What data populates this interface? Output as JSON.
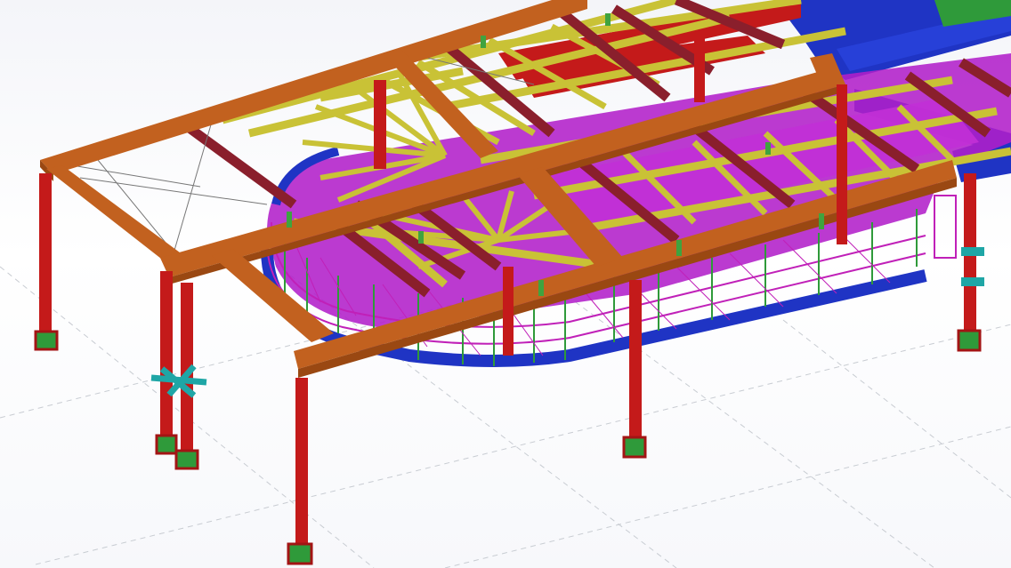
{
  "viewport": {
    "kind": "3d-model-view",
    "background": "#ffffff",
    "grid_line_color": "#c8ccd2"
  },
  "model": {
    "subject": "steel-frame-structure",
    "member_colors": {
      "column": "#c41a1a",
      "main_beam": "#c2611f",
      "secondary_beam": "#c9c236",
      "rafter": "#8a1f2c",
      "curved_walkway": "#b21fc9",
      "walkway_edge": "#1f34c4",
      "railing": "#c020b8",
      "bracket": "#3fa33f",
      "column_base": "#2f9a3a",
      "bracing": "#1fa6a6",
      "cross_brace_wire": "#777777"
    }
  }
}
